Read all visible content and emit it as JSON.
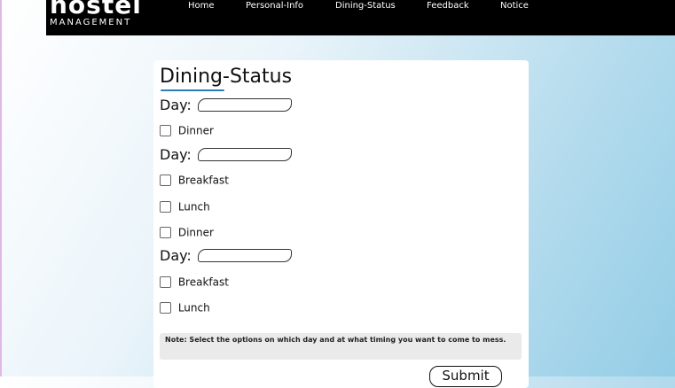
{
  "logo": {
    "main": "hostel",
    "sub": "MANAGEMENT"
  },
  "nav": {
    "items": [
      "Home",
      "Personal-Info",
      "Dining-Status",
      "Feedback",
      "Notice"
    ]
  },
  "form": {
    "title": "Dining-Status",
    "day_label": "Day:",
    "groups": [
      {
        "day_label": "Day:",
        "options": [
          "Dinner"
        ]
      },
      {
        "day_label": "Day:",
        "options": [
          "Breakfast",
          "Lunch",
          "Dinner"
        ]
      },
      {
        "day_label": "Day:",
        "options": [
          "Breakfast",
          "Lunch"
        ]
      }
    ],
    "note": "Note: Select the options on which day and at what timing you want to come to mess.",
    "submit_label": "Submit"
  },
  "colors": {
    "navbar": "#000000",
    "accent": "#2a7db8",
    "note_bg": "#eaeaea"
  }
}
